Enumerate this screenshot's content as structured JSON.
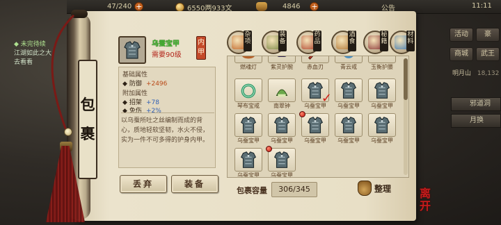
{
  "hud": {
    "stamina": "47/240",
    "currency": "6550两933文",
    "bag_count": "4846",
    "announce_label": "公告",
    "clock": "11:11"
  },
  "quest": {
    "status": "◆ 未完待续",
    "text_1": "江湖如此之大",
    "text_2": "去看看"
  },
  "right_menu": {
    "btn_activity": "活动",
    "btn_gift": "豪",
    "btn_shop": "商城",
    "btn_king": "武王",
    "location": "明月山",
    "coord": "18,132",
    "bar_1": "邪道洞",
    "bar_2": "月换"
  },
  "scroll": {
    "title_1": "包",
    "title_2": "裹"
  },
  "item": {
    "name": "乌蚕宝甲",
    "requirement": "需要90级",
    "slot_badge": "内甲",
    "basic_header": "基础属性",
    "defense_label": "防御",
    "defense_value": "+2496",
    "extra_header": "附加属性",
    "parry_label": "招架",
    "parry_value": "+78",
    "immune_label": "免伤",
    "immune_value": "+2%",
    "description": "以乌蚕所吐之丝编制而成的背心，质地轻软坚韧，水火不侵，实为一件不可多得的护身内甲。"
  },
  "buttons": {
    "discard": "丢弃",
    "equip": "装备",
    "sort": "整理"
  },
  "tabs": [
    {
      "label": "杂项",
      "icon": "gourd-icon",
      "color": "#c1692c"
    },
    {
      "label": "装备",
      "icon": "armor-icon",
      "color": "#7f8a4a"
    },
    {
      "label": "药品",
      "icon": "herb-icon",
      "color": "#b24b33"
    },
    {
      "label": "酒食",
      "icon": "wine-icon",
      "color": "#b37a3a"
    },
    {
      "label": "秘籍",
      "icon": "book-icon",
      "color": "#8c3a3a"
    },
    {
      "label": "材料",
      "icon": "crystal-icon",
      "color": "#4d7fae"
    }
  ],
  "grid": {
    "row0": [
      {
        "label": "燃魂灯",
        "icon": "lamp-icon"
      },
      {
        "label": "紫灵护腕",
        "icon": "bracer-icon"
      },
      {
        "label": "赤血刃",
        "icon": "blade-icon"
      },
      {
        "label": "青云戒",
        "icon": "ring-icon"
      },
      {
        "label": "玉衡护腰",
        "icon": "belt-icon"
      }
    ],
    "row1": [
      {
        "label": "琴布宝戒",
        "icon": "jade-ring-icon",
        "dot": false,
        "check": false
      },
      {
        "label": "南翠钟",
        "icon": "green-bell-icon",
        "dot": false,
        "check": false
      },
      {
        "label": "乌蚕宝甲",
        "icon": "armor-icon",
        "dot": false,
        "check": true
      },
      {
        "label": "乌蚕宝甲",
        "icon": "armor-icon",
        "dot": false,
        "check": false
      },
      {
        "label": "乌蚕宝甲",
        "icon": "armor-icon",
        "dot": false,
        "check": false
      }
    ],
    "row2": [
      {
        "label": "乌蚕宝甲",
        "icon": "armor-icon",
        "dot": false
      },
      {
        "label": "乌蚕宝甲",
        "icon": "armor-icon",
        "dot": false
      },
      {
        "label": "乌蚕宝甲",
        "icon": "armor-icon",
        "dot": true
      },
      {
        "label": "乌蚕宝甲",
        "icon": "armor-icon",
        "dot": false
      },
      {
        "label": "乌蚕宝甲",
        "icon": "armor-icon",
        "dot": false
      }
    ],
    "row3": [
      {
        "label": "乌蚕宝甲",
        "icon": "armor-icon",
        "dot": false
      },
      {
        "label": "乌蚕宝甲",
        "icon": "armor-icon",
        "dot": true
      }
    ]
  },
  "capacity": {
    "label": "包裹容量",
    "value": "306/345"
  },
  "logo_text": "离开",
  "colors": {
    "item_name_green": "#3fb52b",
    "requirement_red": "#b3261b",
    "attr_blue": "#2f5fb5"
  }
}
